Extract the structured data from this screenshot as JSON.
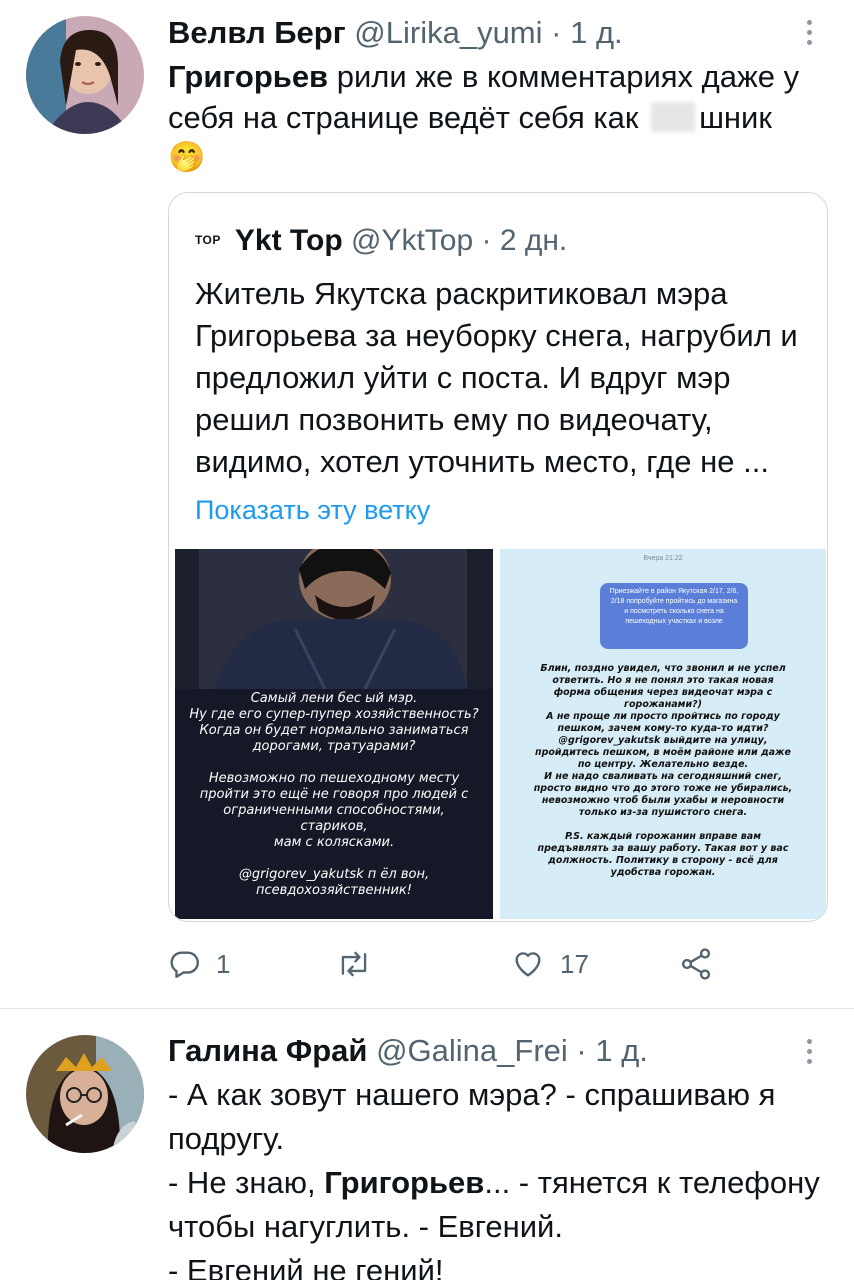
{
  "tweet1": {
    "name": "Велвл Берг",
    "handle": "@Lirika_yumi",
    "time": "· 1 д.",
    "text_mention": "Григорьев",
    "text_line1_rest": " рили же в комментариях даже у",
    "text_line2_before": "себя на странице ведёт себя как ",
    "text_line2_after": "шник",
    "emoji": "🤭",
    "quote": {
      "logo": "ТОР",
      "name": "Ykt Top",
      "handle": "@YktTop",
      "time": "· 2 дн.",
      "text": "Житель Якутска раскритиковал мэра Григорьева за неуборку снега, нагрубил и предложил уйти с поста. И вдруг мэр решил позвонить ему по видеочату, видимо, хотел уточнить место, где не ...",
      "show_thread": "Показать эту ветку",
      "left_image": {
        "lines": [
          "Самый лени        бес              ый мэр.",
          "Ну где его супер-пупер хозяйственность?",
          "Когда он будет нормально заниматься",
          "дорогами, тратуарами?",
          "",
          "Невозможно по пешеходному месту",
          "пройти это ещё не говоря про людей с",
          "ограниченными способностями,",
          "стариков,",
          "мам с колясками.",
          "",
          "@grigorev_yakutsk п       ёл вон,",
          "псевдохозяйственник!"
        ]
      },
      "right_image": {
        "date": "Вчера 21:22",
        "bubble": "Приезжайте в район Якутская 2/17, 2/6, 2/18 попробуйте пройтись до магазина и посмотреть сколько снега на пешеходных участках и возле",
        "lines": [
          "Блин, поздно увидел, что звонил и не успел",
          "ответить. Но я не понял это такая новая",
          "форма общения через видеочат мэра с",
          "горожанами?)",
          "А не проще ли просто пройтись по городу",
          "пешком, зачем кому-то куда-то идти?",
          "@grigorev_yakutsk выйдите на улицу,",
          "пройдитесь пешком, в моём районе или даже",
          "по центру. Желательно везде.",
          "И не надо сваливать на сегодняшний снег,",
          "просто видно что до этого тоже не убирались,",
          "невозможно чтоб были ухабы и неровности",
          "только из-за пушистого снега.",
          "",
          "P.S. каждый горожанин вправе вам",
          "предъявлять за вашу работу. Такая вот у вас",
          "должность. Политику в сторону - всё для",
          "удобства горожан."
        ]
      }
    },
    "actions": {
      "replies": "1",
      "retweets": "",
      "likes": "17"
    }
  },
  "tweet2": {
    "name": "Галина Фрай",
    "handle": "@Galina_Frei",
    "time": "· 1 д.",
    "line1": "- А как зовут нашего мэра? - спрашиваю я",
    "line2": "подругу.",
    "line3_before": "- Не знаю, ",
    "line3_bold": "Григорьев",
    "line3_after": "... - тянется к телефону",
    "line4": "чтобы нагуглить. - Евгений.",
    "line5": "- Евгений не гений!"
  },
  "colors": {
    "accent": "#1d9bf0",
    "secondary_text": "#536471",
    "border": "#cfd9de"
  }
}
